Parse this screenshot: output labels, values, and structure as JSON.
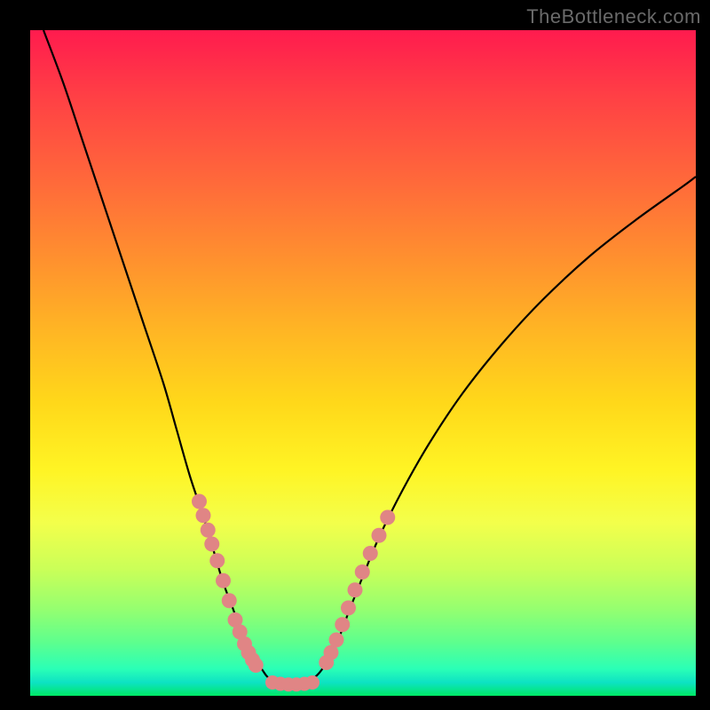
{
  "watermark": "TheBottleneck.com",
  "colors": {
    "background": "#000000",
    "curve": "#000000",
    "dots": "#e08585",
    "gradient_top": "#ff1b4e",
    "gradient_bottom": "#00e865"
  },
  "chart_data": {
    "type": "line",
    "title": "",
    "xlabel": "",
    "ylabel": "",
    "xlim": [
      0,
      100
    ],
    "ylim": [
      0,
      100
    ],
    "series": [
      {
        "name": "left-curve",
        "x": [
          2,
          5,
          8,
          11,
          14,
          17,
          20,
          22,
          24,
          26,
          27.5,
          29,
          30.5,
          31.5,
          32.5,
          33.2,
          34,
          34.8,
          35.5,
          36.2,
          37
        ],
        "y": [
          100,
          92,
          83,
          74,
          65,
          56,
          47,
          40,
          33,
          27,
          22,
          17,
          13,
          10,
          8,
          6,
          5,
          4,
          3,
          2.4,
          2
        ]
      },
      {
        "name": "valley-floor",
        "x": [
          35.5,
          37,
          38.5,
          40,
          41.5,
          43
        ],
        "y": [
          2.4,
          2,
          1.8,
          1.8,
          2,
          2.4
        ]
      },
      {
        "name": "right-curve",
        "x": [
          41,
          42,
          43,
          44,
          45,
          46.5,
          48,
          50,
          52.5,
          56,
          60,
          65,
          71,
          77,
          84,
          91,
          98,
          100
        ],
        "y": [
          2,
          2.4,
          3,
          4.2,
          6,
          9,
          13,
          18,
          24,
          31,
          38,
          45.5,
          53,
          59.5,
          66,
          71.5,
          76.5,
          78
        ]
      }
    ],
    "dots_left": {
      "name": "left-dots",
      "x": [
        25.4,
        26.0,
        26.7,
        27.3,
        28.1,
        29.0,
        29.9,
        30.8,
        31.5,
        32.2,
        32.8,
        33.4,
        33.9
      ],
      "y": [
        29.2,
        27.1,
        24.9,
        22.8,
        20.3,
        17.3,
        14.3,
        11.4,
        9.6,
        7.8,
        6.5,
        5.4,
        4.6
      ]
    },
    "dots_right": {
      "name": "right-dots",
      "x": [
        44.5,
        45.2,
        46.0,
        46.9,
        47.8,
        48.8,
        49.9,
        51.1,
        52.4,
        53.7
      ],
      "y": [
        5.0,
        6.5,
        8.4,
        10.7,
        13.2,
        15.9,
        18.6,
        21.4,
        24.1,
        26.8
      ]
    },
    "dots_floor": {
      "name": "floor-dots",
      "x": [
        36.4,
        37.6,
        38.8,
        40.0,
        41.2,
        42.4
      ],
      "y": [
        2.0,
        1.8,
        1.7,
        1.7,
        1.8,
        2.0
      ]
    }
  }
}
